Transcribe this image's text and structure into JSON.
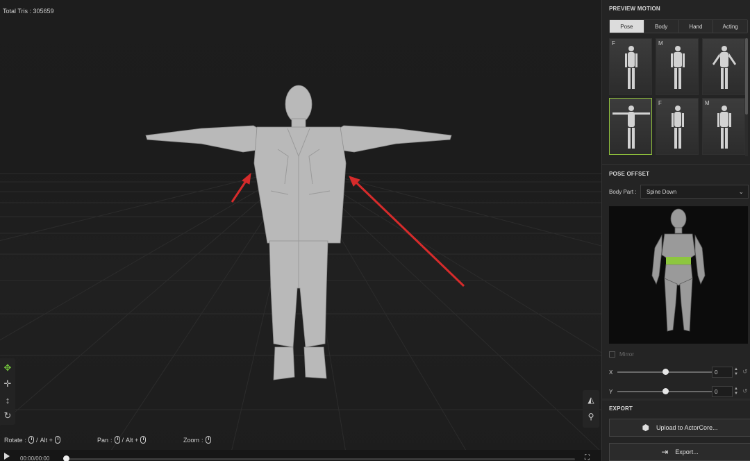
{
  "viewport": {
    "total_tris": "Total Tris : 305659",
    "tools": {
      "move_icon": "move-arrows-icon",
      "pan_icon": "pan-icon",
      "vertical_icon": "vertical-move-icon",
      "rotate_icon": "rotate-icon"
    },
    "hints": {
      "rotate_label": "Rotate",
      "rotate_alt": "Alt +",
      "pan_label": "Pan",
      "pan_alt": "Alt +",
      "zoom_label": "Zoom",
      "sep": ":",
      "slash": "/"
    },
    "timeline": {
      "time": "00:00/00:00",
      "progress": 0
    }
  },
  "panel": {
    "preview_motion": {
      "title": "PREVIEW MOTION",
      "tabs": [
        "Pose",
        "Body",
        "Hand",
        "Acting"
      ],
      "active_tab": "Pose",
      "thumbnails": [
        {
          "tag": "F"
        },
        {
          "tag": "M"
        },
        {
          "tag": ""
        },
        {
          "tag": ""
        },
        {
          "tag": "F"
        },
        {
          "tag": "M"
        }
      ]
    },
    "pose_offset": {
      "title": "POSE OFFSET",
      "body_part_label": "Body Part :",
      "body_part_value": "Spine Down",
      "mirror_label": "Mirror",
      "axes": [
        {
          "label": "X",
          "value": "0"
        },
        {
          "label": "Y",
          "value": "0"
        }
      ]
    },
    "export": {
      "title": "EXPORT",
      "upload_label": "Upload to ActorCore...",
      "export_label": "Export..."
    }
  },
  "colors": {
    "accent_green": "#8fbf3c",
    "highlight_green": "#8dc63f",
    "arrow_red": "#d62b2b"
  }
}
